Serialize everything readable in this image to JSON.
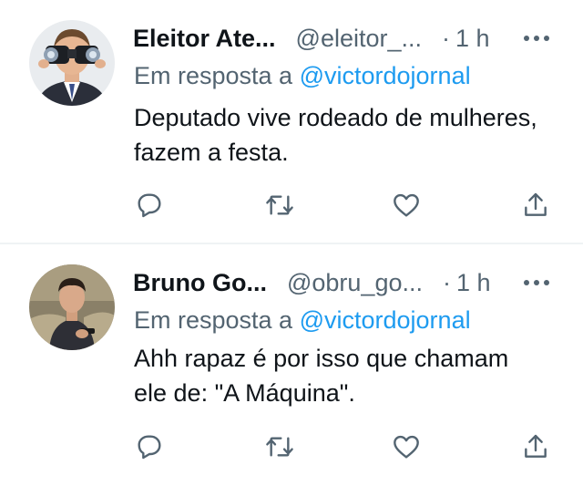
{
  "tweets": [
    {
      "author_name": "Eleitor Ate...",
      "handle": "@eleitor_...",
      "separator": "·",
      "time": "1 h",
      "reply_prefix": "Em resposta a",
      "reply_to": "@victordojornal",
      "text_lines": [
        "Deputado vive rodeado de mulheres,",
        "fazem a festa."
      ],
      "avatar_icon": "man-with-binoculars-avatar"
    },
    {
      "author_name": "Bruno Go...",
      "handle": "@obru_go...",
      "separator": "·",
      "time": "1 h",
      "reply_prefix": "Em resposta a",
      "reply_to": "@victordojornal",
      "text_lines": [
        "Ahh rapaz é por isso que chamam",
        "ele de: \"A Máquina\"."
      ],
      "avatar_icon": "man-on-sofa-avatar"
    }
  ],
  "actions": [
    "reply-icon",
    "retweet-icon",
    "like-icon",
    "share-icon"
  ],
  "colors": {
    "text": "#0f1419",
    "secondary": "#536471",
    "link": "#1d9bf0",
    "divider": "#eff3f4"
  }
}
